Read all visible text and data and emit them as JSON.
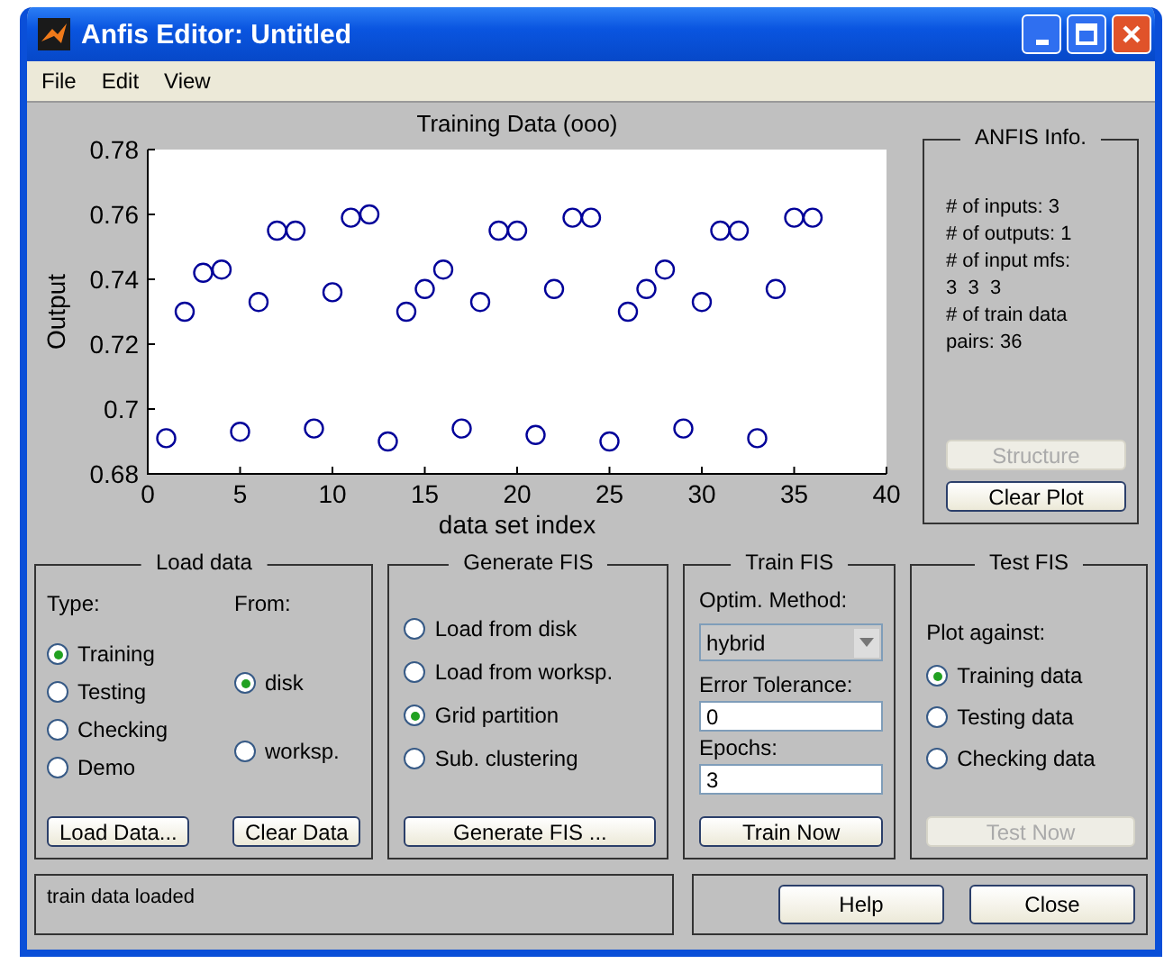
{
  "window": {
    "title": "Anfis Editor: Untitled"
  },
  "menu": [
    "File",
    "Edit",
    "View"
  ],
  "plot": {
    "chart_data": {
      "type": "scatter",
      "title": "Training Data (ooo)",
      "xlabel": "data set index",
      "ylabel": "Output",
      "x": [
        1,
        2,
        3,
        4,
        5,
        6,
        7,
        8,
        9,
        10,
        11,
        12,
        13,
        14,
        15,
        16,
        17,
        18,
        19,
        20,
        21,
        22,
        23,
        24,
        25,
        26,
        27,
        28,
        29,
        30,
        31,
        32,
        33,
        34,
        35,
        36
      ],
      "series": [
        {
          "color": "#000099",
          "values": [
            0.691,
            0.73,
            0.742,
            0.743,
            0.693,
            0.733,
            0.755,
            0.755,
            0.694,
            0.736,
            0.759,
            0.76,
            0.69,
            0.73,
            0.737,
            0.743,
            0.694,
            0.733,
            0.755,
            0.755,
            0.692,
            0.737,
            0.759,
            0.759,
            0.69,
            0.73,
            0.737,
            0.743,
            0.694,
            0.733,
            0.755,
            0.755,
            0.691,
            0.737,
            0.759,
            0.759
          ]
        }
      ],
      "xlim": [
        0,
        40
      ],
      "ylim": [
        0.68,
        0.78
      ],
      "xticks": [
        0,
        5,
        10,
        15,
        20,
        25,
        30,
        35,
        40
      ],
      "yticks": [
        0.68,
        0.7,
        0.72,
        0.74,
        0.76,
        0.78
      ]
    }
  },
  "anfis_info": {
    "title": "ANFIS Info.",
    "lines": [
      "# of inputs: 3",
      "# of outputs: 1",
      "# of input mfs:",
      "3  3  3",
      "# of train data",
      "pairs: 36"
    ],
    "buttons": [
      {
        "label": "Structure",
        "disabled": true
      },
      {
        "label": "Clear Plot",
        "disabled": false
      }
    ]
  },
  "load_data": {
    "title": "Load data",
    "type_label": "Type:",
    "from_label": "From:",
    "type_options": [
      {
        "label": "Training",
        "selected": true
      },
      {
        "label": "Testing",
        "selected": false
      },
      {
        "label": "Checking",
        "selected": false
      },
      {
        "label": "Demo",
        "selected": false
      }
    ],
    "from_options": [
      {
        "label": "disk",
        "selected": true
      },
      {
        "label": "worksp.",
        "selected": false
      }
    ],
    "buttons": [
      "Load Data...",
      "Clear Data"
    ]
  },
  "generate_fis": {
    "title": "Generate FIS",
    "options": [
      {
        "label": "Load from disk",
        "selected": false
      },
      {
        "label": "Load from worksp.",
        "selected": false
      },
      {
        "label": "Grid partition",
        "selected": true
      },
      {
        "label": "Sub. clustering",
        "selected": false
      }
    ],
    "button": "Generate FIS ..."
  },
  "train_fis": {
    "title": "Train FIS",
    "method_label": "Optim. Method:",
    "method": "hybrid",
    "error_tolerance_label": "Error Tolerance:",
    "error_tolerance": "0",
    "epochs_label": "Epochs:",
    "epochs": "3",
    "button": "Train Now"
  },
  "test_fis": {
    "title": "Test FIS",
    "plot_against_label": "Plot against:",
    "options": [
      {
        "label": "Training data",
        "selected": true
      },
      {
        "label": "Testing data",
        "selected": false
      },
      {
        "label": "Checking data",
        "selected": false
      }
    ],
    "button": {
      "label": "Test Now",
      "disabled": true
    }
  },
  "status_bar": "train data loaded",
  "buttons": [
    "Help",
    "Close"
  ]
}
